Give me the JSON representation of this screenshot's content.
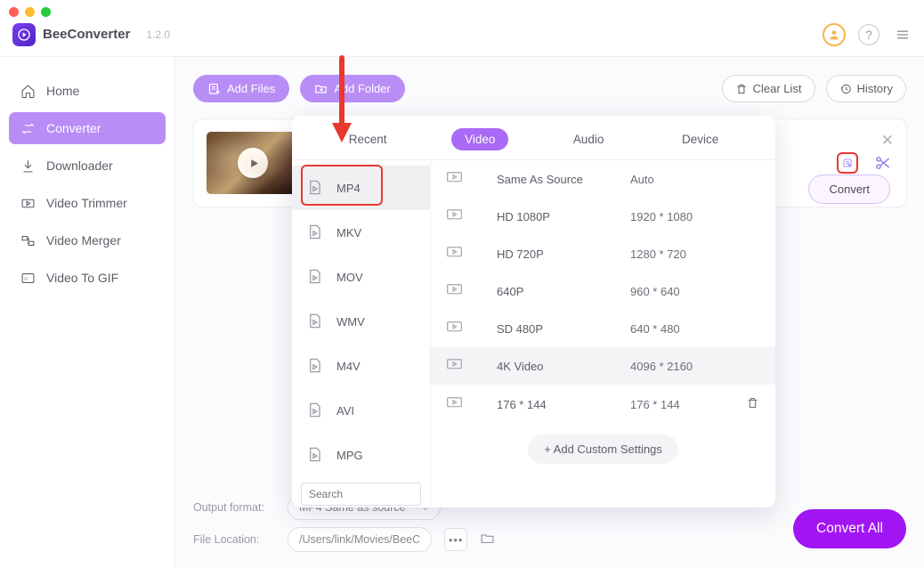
{
  "app": {
    "name": "BeeConverter",
    "version": "1.2.0"
  },
  "sidebar": {
    "items": [
      {
        "label": "Home"
      },
      {
        "label": "Converter"
      },
      {
        "label": "Downloader"
      },
      {
        "label": "Video Trimmer"
      },
      {
        "label": "Video Merger"
      },
      {
        "label": "Video To GIF"
      }
    ]
  },
  "toolbar": {
    "add_files": "Add Files",
    "add_folder": "Add Folder",
    "clear_list": "Clear List",
    "history": "History"
  },
  "card": {
    "convert_label": "Convert"
  },
  "popup": {
    "tabs": {
      "recent": "Recent",
      "video": "Video",
      "audio": "Audio",
      "device": "Device"
    },
    "formats": [
      "MP4",
      "MKV",
      "MOV",
      "WMV",
      "M4V",
      "AVI",
      "MPG"
    ],
    "resolutions": [
      {
        "label": "Same As Source",
        "dim": "Auto"
      },
      {
        "label": "HD 1080P",
        "dim": "1920 * 1080"
      },
      {
        "label": "HD 720P",
        "dim": "1280 * 720"
      },
      {
        "label": "640P",
        "dim": "960 * 640"
      },
      {
        "label": "SD 480P",
        "dim": "640 * 480"
      },
      {
        "label": "4K Video",
        "dim": "4096 * 2160"
      },
      {
        "label": "176 * 144",
        "dim": "176 * 144"
      }
    ],
    "search_placeholder": "Search",
    "add_custom": "+ Add Custom Settings"
  },
  "footer": {
    "output_format_label": "Output format:",
    "output_format_value": "MP4 Same as source",
    "file_location_label": "File Location:",
    "file_location_value": "/Users/link/Movies/BeeC",
    "convert_all": "Convert All"
  }
}
